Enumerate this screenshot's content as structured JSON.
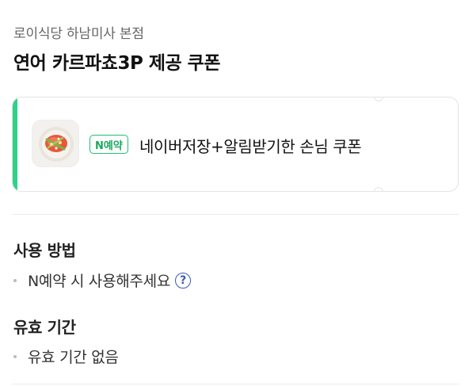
{
  "header": {
    "store_name": "로이식당 하남미사 본점",
    "coupon_title": "연어 카르파쵸3P 제공 쿠폰"
  },
  "coupon": {
    "badge": "N예약",
    "name": "네이버저장+알림받기한 손님 쿠폰",
    "accent_color": "#2fd388",
    "thumbnail_icon": "food-dish-photo"
  },
  "usage": {
    "heading": "사용 방법",
    "items": [
      "N예약 시 사용해주세요"
    ],
    "help_icon": "question-circle-icon"
  },
  "validity": {
    "heading": "유효 기간",
    "items": [
      "유효 기간 없음"
    ]
  }
}
